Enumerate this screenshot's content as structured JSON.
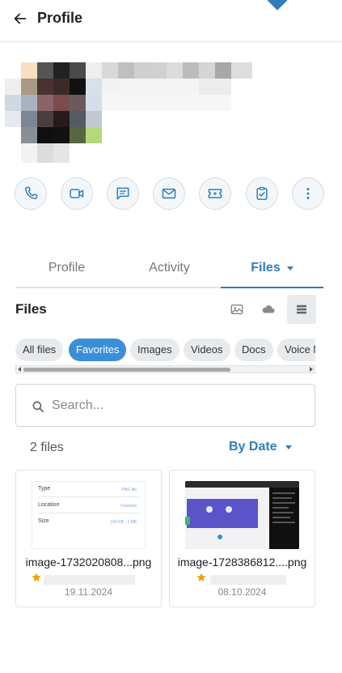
{
  "header": {
    "title": "Profile",
    "back_icon": "arrow-left-icon"
  },
  "actions": [
    {
      "name": "call-button",
      "icon": "phone-icon"
    },
    {
      "name": "video-call-button",
      "icon": "video-icon"
    },
    {
      "name": "message-button",
      "icon": "chat-icon"
    },
    {
      "name": "email-button",
      "icon": "mail-icon"
    },
    {
      "name": "ticket-button",
      "icon": "ticket-icon"
    },
    {
      "name": "task-button",
      "icon": "clipboard-check-icon"
    },
    {
      "name": "more-button",
      "icon": "more-vertical-icon"
    }
  ],
  "tabs": [
    {
      "label": "Profile",
      "active": false
    },
    {
      "label": "Activity",
      "active": false
    },
    {
      "label": "Files",
      "active": true
    }
  ],
  "files_section": {
    "title": "Files",
    "view_buttons": [
      {
        "name": "gallery-view-button",
        "icon": "gallery-icon",
        "active": false
      },
      {
        "name": "cloud-view-button",
        "icon": "cloud-icon",
        "active": false
      },
      {
        "name": "list-view-button",
        "icon": "list-icon",
        "active": true
      }
    ]
  },
  "filters": [
    {
      "label": "All files",
      "active": false
    },
    {
      "label": "Favorites",
      "active": true
    },
    {
      "label": "Images",
      "active": false
    },
    {
      "label": "Videos",
      "active": false
    },
    {
      "label": "Docs",
      "active": false
    },
    {
      "label": "Voice M",
      "active": false
    }
  ],
  "search": {
    "placeholder": "Search...",
    "value": ""
  },
  "list": {
    "count": "2 files",
    "sort_label": "By Date"
  },
  "files": [
    {
      "name": "image-1732020808...png",
      "date": "19.11.2024",
      "favorite": true,
      "thumb_rows": [
        {
          "label": "Type",
          "value": "PNG file"
        },
        {
          "label": "Location",
          "value": "Contacts"
        },
        {
          "label": "Size",
          "value": "100 KB · 1 MB"
        }
      ]
    },
    {
      "name": "image-1728386812....png",
      "date": "08.10.2024",
      "favorite": true
    }
  ],
  "colors": {
    "accent": "#2f7dbd",
    "chip_active": "#3a8fd8",
    "star": "#f0a500"
  }
}
